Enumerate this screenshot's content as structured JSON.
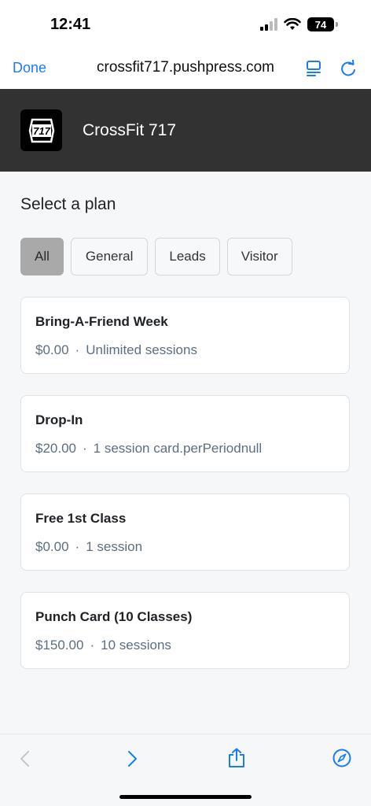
{
  "status": {
    "time": "12:41",
    "battery": "74"
  },
  "browser": {
    "done_label": "Done",
    "url": "crossfit717.pushpress.com"
  },
  "app": {
    "title": "CrossFit 717",
    "logo_text": "717"
  },
  "page": {
    "section_title": "Select a plan",
    "filters": [
      {
        "label": "All",
        "active": true
      },
      {
        "label": "General",
        "active": false
      },
      {
        "label": "Leads",
        "active": false
      },
      {
        "label": "Visitor",
        "active": false
      }
    ],
    "plans": [
      {
        "name": "Bring-A-Friend Week",
        "price": "$0.00",
        "separator": "·",
        "detail": "Unlimited sessions"
      },
      {
        "name": "Drop-In",
        "price": "$20.00",
        "separator": "·",
        "detail": "1 session card.perPeriodnull"
      },
      {
        "name": "Free 1st Class",
        "price": "$0.00",
        "separator": "·",
        "detail": "1 session"
      },
      {
        "name": "Punch Card (10 Classes)",
        "price": "$150.00",
        "separator": "·",
        "detail": "10 sessions"
      }
    ]
  },
  "colors": {
    "accent": "#1a7cf3",
    "header_bg": "#323232",
    "active_filter": "#a9a9a9"
  },
  "icons": [
    "signal-icon",
    "wifi-icon",
    "battery-icon",
    "reader-mode-icon",
    "reload-icon",
    "back-icon",
    "forward-icon",
    "share-icon",
    "compass-icon"
  ]
}
